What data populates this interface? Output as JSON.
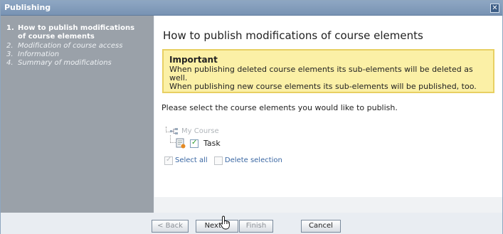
{
  "dialog": {
    "title": "Publishing",
    "close_glyph": "✕"
  },
  "steps": [
    {
      "num": "1.",
      "label": "How to publish modifications of course elements",
      "active": true
    },
    {
      "num": "2.",
      "label": "Modification of course access",
      "active": false
    },
    {
      "num": "3.",
      "label": "Information",
      "active": false
    },
    {
      "num": "4.",
      "label": "Summary of modifications",
      "active": false
    }
  ],
  "main": {
    "heading": "How to publish modifications of course elements",
    "important_title": "Important",
    "important_line1": "When publishing deleted course elements its sub-elements will be deleted as well.",
    "important_line2": "When publishing new course elements its sub-elements will be published, too.",
    "instruction": "Please select the course elements you would like to publish.",
    "tree": {
      "root_label": "My Course",
      "root_icon": "course-tree-icon",
      "task_label": "Task",
      "task_icon": "task-icon",
      "task_checked": true
    },
    "select_all": "Select all",
    "delete_selection": "Delete selection"
  },
  "buttons": {
    "back": "< Back",
    "next": "Next >",
    "finish": "Finish",
    "cancel": "Cancel"
  },
  "colors": {
    "titlebar": "#7e98b8",
    "sidebar": "#9aa1a9",
    "important_bg": "#fbf0a6",
    "link": "#3a67a3"
  }
}
